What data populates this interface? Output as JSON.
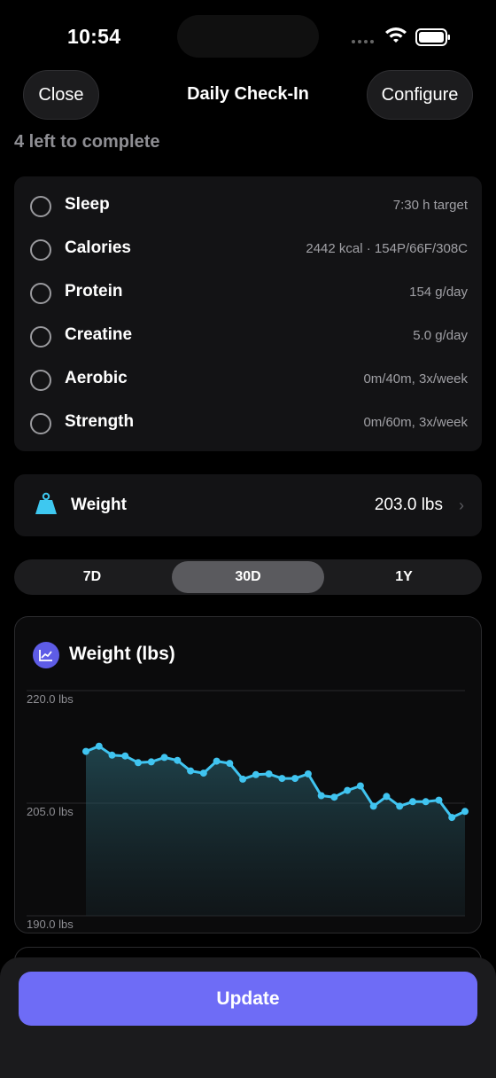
{
  "status_bar": {
    "time": "10:54"
  },
  "nav": {
    "close_label": "Close",
    "title": "Daily Check-In",
    "configure_label": "Configure"
  },
  "subtitle": "4 left to complete",
  "checklist": [
    {
      "label": "Sleep",
      "value": "7:30 h target"
    },
    {
      "label": "Calories",
      "value": "2442 kcal · 154P/66F/308C"
    },
    {
      "label": "Protein",
      "value": "154 g/day"
    },
    {
      "label": "Creatine",
      "value": "5.0 g/day"
    },
    {
      "label": "Aerobic",
      "value": "0m/40m, 3x/week"
    },
    {
      "label": "Strength",
      "value": "0m/60m, 3x/week"
    }
  ],
  "weight": {
    "label": "Weight",
    "value": "203.0 lbs",
    "icon": "scale-icon"
  },
  "range_tabs": {
    "options": [
      "7D",
      "30D",
      "1Y"
    ],
    "selected": "30D"
  },
  "chart_card": {
    "title": "Weight (lbs)",
    "icon": "trend-chart-icon"
  },
  "chart_data": {
    "type": "area",
    "title": "Weight (lbs)",
    "xlabel": "",
    "ylabel": "",
    "ylim": [
      190,
      220
    ],
    "yticks": [
      "220.0 lbs",
      "205.0 lbs",
      "190.0 lbs"
    ],
    "grid": true,
    "series": [
      {
        "values": [
          211.9,
          212.6,
          211.4,
          211.3,
          210.4,
          210.5,
          211.1,
          210.7,
          209.3,
          209.0,
          210.6,
          210.3,
          208.2,
          208.8,
          208.9,
          208.3,
          208.3,
          208.9,
          206.0,
          205.8,
          206.7,
          207.3,
          204.6,
          205.9,
          204.6,
          205.2,
          205.2,
          205.4,
          203.1,
          203.9
        ],
        "color": "#40c4f0"
      }
    ]
  },
  "update_button": {
    "label": "Update"
  },
  "colors": {
    "accent": "#6e6cf6",
    "line": "#40c4f0",
    "card": "#131315",
    "scale_icon": "#3ec8f0"
  }
}
